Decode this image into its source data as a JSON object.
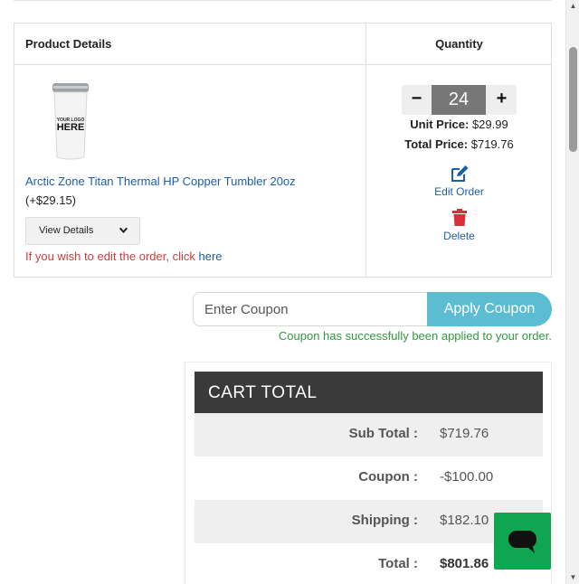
{
  "table": {
    "header_product": "Product Details",
    "header_quantity": "Quantity"
  },
  "product": {
    "image_text_top": "YOUR LOGO",
    "image_text_bottom": "HERE",
    "name": "Arctic Zone Titan Thermal HP Copper Tumbler 20oz",
    "price_addon": "(+$29.15)",
    "view_details_label": "View Details",
    "edit_note": "If you wish to edit the order, click",
    "edit_link": "here"
  },
  "quantity": {
    "minus": "−",
    "plus": "+",
    "value": "24",
    "unit_price_label": "Unit Price:",
    "unit_price_value": "$29.99",
    "total_price_label": "Total Price:",
    "total_price_value": "$719.76",
    "edit_order_label": "Edit Order",
    "delete_label": "Delete"
  },
  "coupon": {
    "placeholder": "Enter Coupon",
    "button_label": "Apply Coupon",
    "success_message": "Coupon has successfully been applied to your order."
  },
  "cart_total": {
    "title": "CART TOTAL",
    "rows": [
      {
        "label": "Sub Total :",
        "value": "$719.76"
      },
      {
        "label": "Coupon :",
        "value": "-$100.00"
      },
      {
        "label": "Shipping :",
        "value": "$182.10"
      },
      {
        "label": "Total :",
        "value": "$801.86"
      }
    ]
  },
  "colors": {
    "link_blue": "#1d5fa6",
    "coupon_button": "#5bbcd2",
    "success_green": "#2e9a3e",
    "error_red": "#d33a3a",
    "header_dark": "#3a3a3a",
    "chat_green": "#0fa652"
  },
  "icons": {
    "edit": "edit-icon",
    "delete": "trash-icon",
    "chat": "chat-bubble-icon",
    "dropdown": "chevron-down-icon"
  }
}
